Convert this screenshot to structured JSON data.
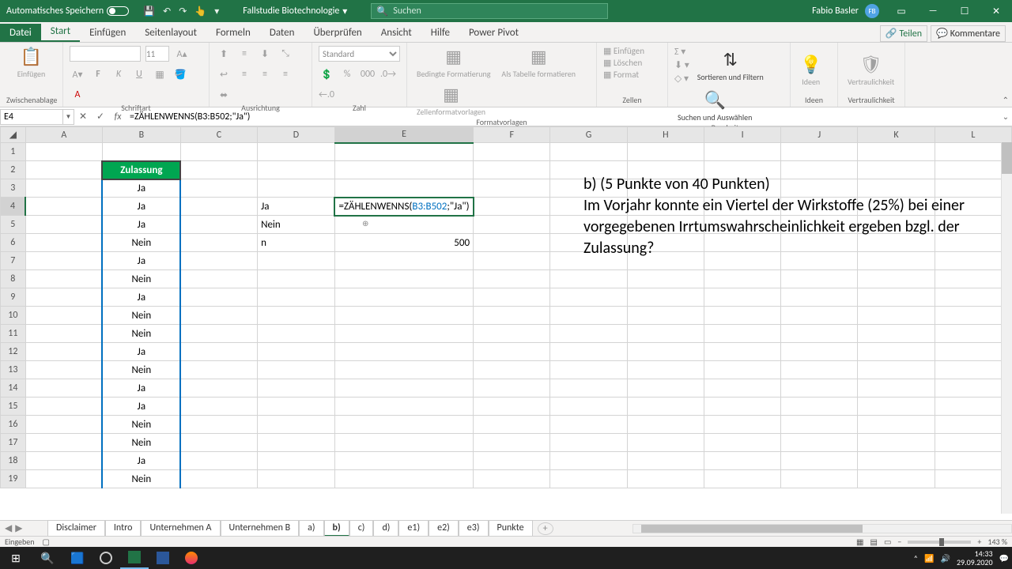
{
  "titlebar": {
    "autosave_label": "Automatisches Speichern",
    "doc_name": "Fallstudie Biotechnologie",
    "search_placeholder": "Suchen",
    "user_name": "Fabio Basler",
    "user_initials": "FB"
  },
  "ribbon_tabs": {
    "file": "Datei",
    "home": "Start",
    "insert": "Einfügen",
    "page_layout": "Seitenlayout",
    "formulas": "Formeln",
    "data": "Daten",
    "review": "Überprüfen",
    "view": "Ansicht",
    "help": "Hilfe",
    "power_pivot": "Power Pivot",
    "share": "Teilen",
    "comments": "Kommentare"
  },
  "ribbon": {
    "clipboard": {
      "paste": "Einfügen",
      "label": "Zwischenablage"
    },
    "font": {
      "size": "11",
      "label": "Schriftart"
    },
    "alignment": {
      "label": "Ausrichtung"
    },
    "number": {
      "format": "Standard",
      "label": "Zahl"
    },
    "styles": {
      "cond": "Bedingte Formatierung",
      "table": "Als Tabelle formatieren",
      "cell": "Zellenformatvorlagen",
      "label": "Formatvorlagen"
    },
    "cells": {
      "insert": "Einfügen",
      "delete": "Löschen",
      "format": "Format",
      "label": "Zellen"
    },
    "editing": {
      "sort": "Sortieren und Filtern",
      "find": "Suchen und Auswählen",
      "label": "Bearbeiten"
    },
    "ideas": {
      "btn": "Ideen",
      "label": "Ideen"
    },
    "sensitivity": {
      "btn": "Vertraulichkeit",
      "label": "Vertraulichkeit"
    }
  },
  "formula_bar": {
    "name_box": "E4",
    "formula": "=ZÄHLENWENNS(B3:B502;\"Ja\")"
  },
  "columns": [
    "A",
    "B",
    "C",
    "D",
    "E",
    "F",
    "G",
    "H",
    "I",
    "J",
    "K",
    "L"
  ],
  "rows": [
    1,
    2,
    3,
    4,
    5,
    6,
    7,
    8,
    9,
    10,
    11,
    12,
    13,
    14,
    15,
    16,
    17,
    18,
    19
  ],
  "sheet": {
    "header_b2": "Zulassung",
    "col_b": [
      "Ja",
      "Ja",
      "Ja",
      "Nein",
      "Ja",
      "Nein",
      "Ja",
      "Nein",
      "Nein",
      "Ja",
      "Nein",
      "Ja",
      "Ja",
      "Nein",
      "Nein",
      "Ja",
      "Nein"
    ],
    "d4": "Ja",
    "d5": "Nein",
    "d6": "n",
    "e4_formula_plain": "=ZÄHLENWENNS(",
    "e4_formula_ref": "B3:B502",
    "e4_formula_tail": ";\"Ja\")",
    "e6": "500",
    "note_line1": "b)   (5 Punkte von 40 Punkten)",
    "note_line2": "Im Vorjahr konnte ein Viertel der Wirkstoffe (25%) bei einer vorgegebenen Irrtumswahrscheinlichkeit ergeben bzgl. der Zulassung?"
  },
  "sheet_tabs": [
    "Disclaimer",
    "Intro",
    "Unternehmen A",
    "Unternehmen B",
    "a)",
    "b)",
    "c)",
    "d)",
    "e1)",
    "e2)",
    "e3)",
    "Punkte"
  ],
  "active_sheet_tab": "b)",
  "statusbar": {
    "mode": "Eingeben",
    "zoom": "143 %"
  },
  "taskbar": {
    "time": "14:33",
    "date": "29.09.2020"
  }
}
